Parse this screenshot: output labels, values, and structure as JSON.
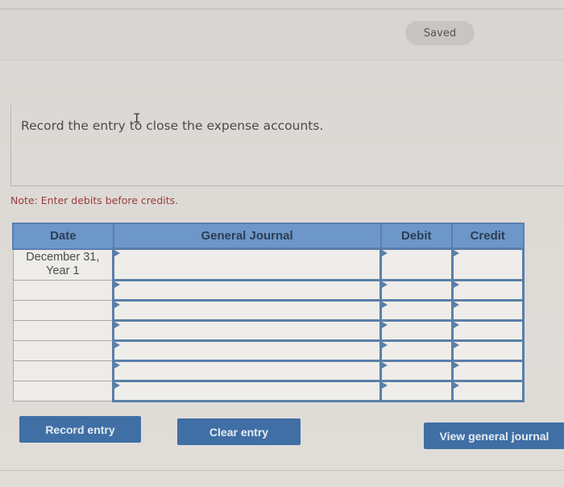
{
  "status": {
    "saved_label": "Saved"
  },
  "question": {
    "prompt": "Record the entry to close the expense accounts.",
    "note": "Note: Enter debits before credits."
  },
  "journal": {
    "headers": {
      "date": "Date",
      "general_journal": "General Journal",
      "debit": "Debit",
      "credit": "Credit"
    },
    "rows": [
      {
        "date": "December 31, Year 1",
        "account": "",
        "debit": "",
        "credit": ""
      },
      {
        "date": "",
        "account": "",
        "debit": "",
        "credit": ""
      },
      {
        "date": "",
        "account": "",
        "debit": "",
        "credit": ""
      },
      {
        "date": "",
        "account": "",
        "debit": "",
        "credit": ""
      },
      {
        "date": "",
        "account": "",
        "debit": "",
        "credit": ""
      },
      {
        "date": "",
        "account": "",
        "debit": "",
        "credit": ""
      },
      {
        "date": "",
        "account": "",
        "debit": "",
        "credit": ""
      }
    ]
  },
  "buttons": {
    "record": "Record entry",
    "clear": "Clear entry",
    "view": "View general journal"
  },
  "icons": {
    "cursor": "text-cursor-icon",
    "cell_marker": "triangle-marker-icon"
  }
}
